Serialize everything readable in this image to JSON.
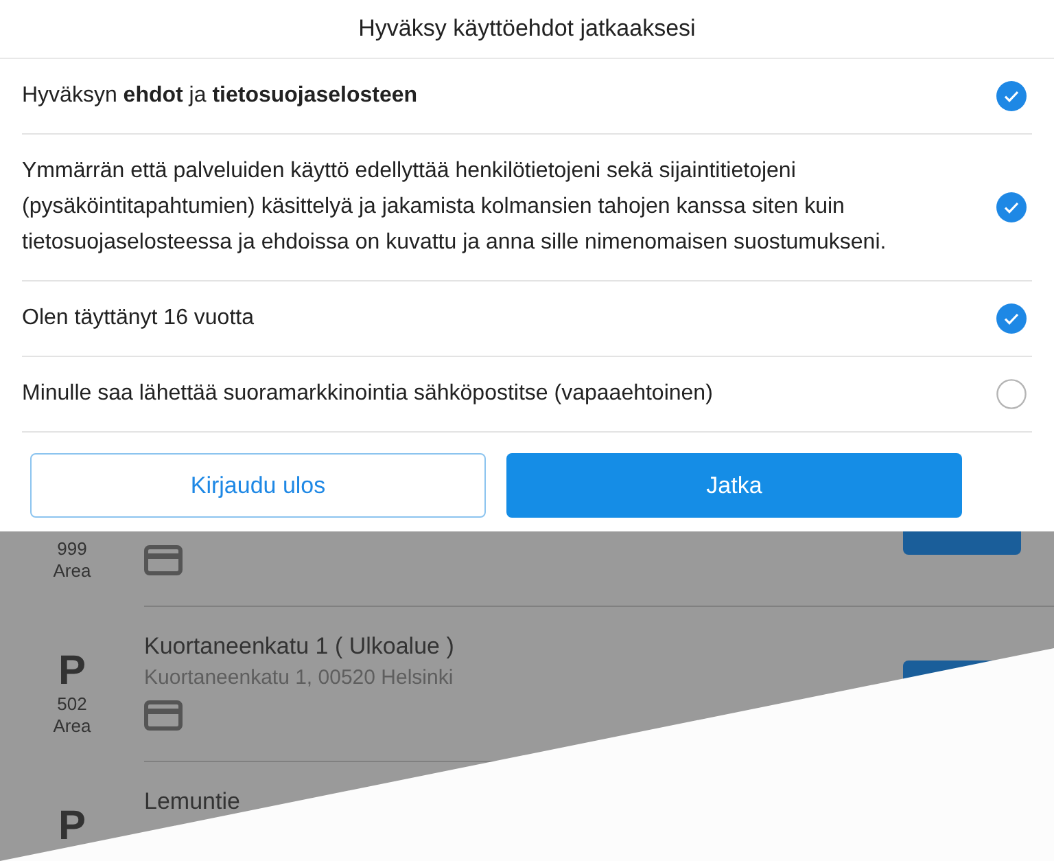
{
  "dialog": {
    "title": "Hyväksy käyttöehdot jatkaaksesi",
    "consents": [
      {
        "text": "Hyväksyn **ehdot** ja **tietosuojaselosteen**",
        "checked": true
      },
      {
        "text": "Ymmärrän että palveluiden käyttö edellyttää henkilötietojeni sekä sijaintitietojeni (pysäköintitapahtumien) käsittelyä ja jakamista kolmansien tahojen kanssa siten kuin tietosuojaselosteessa ja ehdoissa on kuvattu ja anna sille nimenomaisen suostumukseni.",
        "checked": true
      },
      {
        "text": "Olen täyttänyt 16 vuotta",
        "checked": true
      },
      {
        "text": "Minulle saa lähettää suoramarkkinointia sähköpostitse (vapaaehtoinen)",
        "checked": false
      }
    ],
    "buttons": [
      {
        "label": "Kirjaudu ulos",
        "kind": "secondary"
      },
      {
        "label": "Jatka",
        "kind": "primary"
      }
    ]
  },
  "background_list": {
    "items": [
      {
        "number": "999",
        "unit": "Area",
        "card": true,
        "button": true
      },
      {
        "marker": "P",
        "number": "502",
        "unit": "Area",
        "title": "Kuortaneenkatu 1 ( Ulkoalue )",
        "address": "Kuortaneenkatu 1, 00520 Helsinki",
        "card": true,
        "button": true
      },
      {
        "marker": "P",
        "title": "Lemuntie",
        "card": false,
        "button": false
      }
    ]
  }
}
